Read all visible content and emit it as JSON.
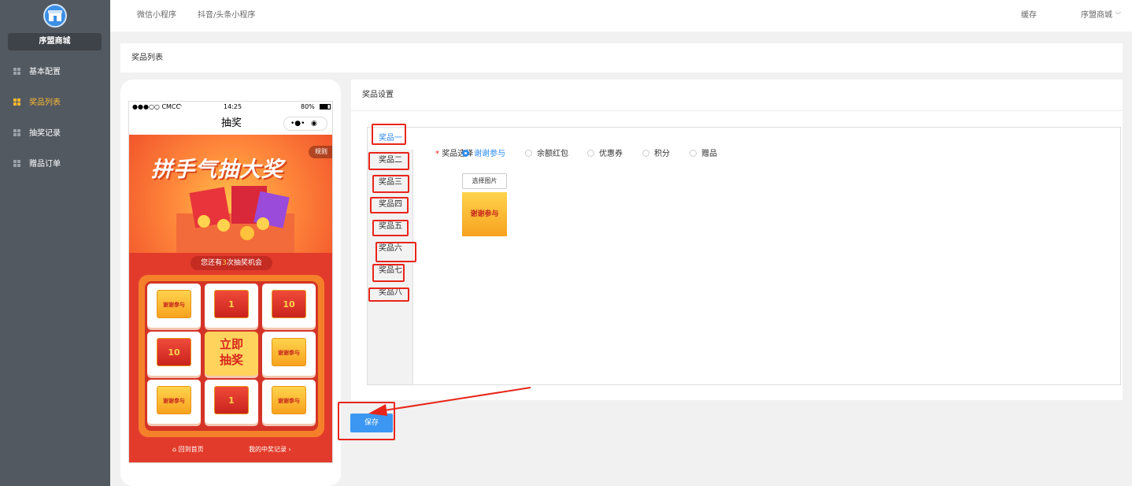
{
  "sidebar": {
    "shop_name": "序盟商城",
    "items": [
      {
        "label": "基本配置",
        "active": false
      },
      {
        "label": "奖品列表",
        "active": true
      },
      {
        "label": "抽奖记录",
        "active": false
      },
      {
        "label": "赠品订单",
        "active": false
      }
    ]
  },
  "topbar": {
    "tabs": [
      "微信小程序",
      "抖音/头条小程序"
    ],
    "cache_label": "缓存",
    "shop_selector": "序盟商城"
  },
  "breadcrumb": "奖品列表",
  "phone": {
    "carrier": "●●●○○ CMCC",
    "time": "14:25",
    "battery": "80%",
    "title": "抽奖",
    "capsule_more": "•●•",
    "capsule_close": "◉",
    "banner_title": "拼手气抽大奖",
    "rule_label": "规则",
    "chances_prefix": "您还有",
    "chances_count": "3",
    "chances_suffix": "次抽奖机会",
    "draw_button": "立即抽奖",
    "cells": [
      "谢谢参与",
      "1",
      "10",
      "10",
      "谢谢参与",
      "谢谢参与",
      "1",
      "谢谢参与"
    ],
    "home_link": "回到首页",
    "records_link": "我的中奖记录"
  },
  "prize_settings": {
    "heading": "奖品设置",
    "tabs": [
      "奖品一",
      "奖品二",
      "奖品三",
      "奖品四",
      "奖品五",
      "奖品六",
      "奖品七",
      "奖品八"
    ],
    "active_tab": "奖品一",
    "field_label": "奖品选择",
    "options": [
      "谢谢参与",
      "余额红包",
      "优惠券",
      "积分",
      "赠品"
    ],
    "selected_option": "谢谢参与",
    "pick_image_button": "选择图片",
    "image_text": "谢谢参与"
  },
  "save_button": "保存",
  "colors": {
    "sidebar_bg": "#535961",
    "active_nav": "#f7b731",
    "primary_blue": "#3b97f2",
    "annotation_red": "#e8251a"
  }
}
